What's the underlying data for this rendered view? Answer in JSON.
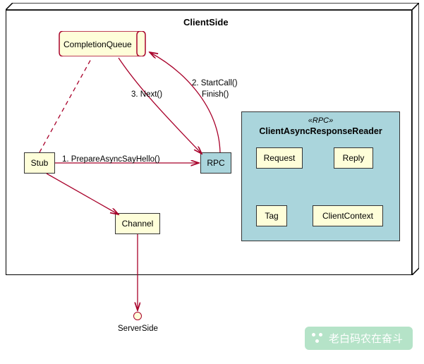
{
  "package": {
    "title": "ClientSide"
  },
  "nodes": {
    "completion_queue": "CompletionQueue",
    "stub": "Stub",
    "channel": "Channel",
    "rpc": "RPC",
    "server_side": "ServerSide"
  },
  "rpc_group": {
    "stereotype": "«RPC»",
    "title": "ClientAsyncResponseReader",
    "members": {
      "request": "Request",
      "reply": "Reply",
      "tag": "Tag",
      "client_context": "ClientContext"
    }
  },
  "edges": {
    "e1": "1. PrepareAsyncSayHello()",
    "e2_a": "2. StartCall()",
    "e2_b": "Finish()",
    "e3": "3. Next()"
  },
  "watermark": "老白码农在奋斗",
  "chart_data": {
    "type": "diagram",
    "title": "ClientSide",
    "nodes": [
      {
        "id": "CompletionQueue",
        "shape": "cylinder"
      },
      {
        "id": "Stub",
        "shape": "box"
      },
      {
        "id": "Channel",
        "shape": "box"
      },
      {
        "id": "RPC",
        "shape": "box"
      },
      {
        "id": "ClientAsyncResponseReader",
        "shape": "group",
        "stereotype": "RPC",
        "children": [
          "Request",
          "Reply",
          "Tag",
          "ClientContext"
        ]
      },
      {
        "id": "ServerSide",
        "shape": "interface"
      }
    ],
    "edges": [
      {
        "from": "Stub",
        "to": "CompletionQueue",
        "style": "dashed"
      },
      {
        "from": "Stub",
        "to": "RPC",
        "label": "1. PrepareAsyncSayHello()",
        "style": "solid-arrow"
      },
      {
        "from": "RPC",
        "to": "CompletionQueue",
        "label": "2. StartCall() Finish()",
        "style": "solid-arrow"
      },
      {
        "from": "CompletionQueue",
        "to": "RPC",
        "label": "3. Next()",
        "style": "solid-arrow"
      },
      {
        "from": "Stub",
        "to": "Channel",
        "style": "solid-arrow"
      },
      {
        "from": "Channel",
        "to": "ServerSide",
        "style": "solid-arrow"
      }
    ]
  }
}
